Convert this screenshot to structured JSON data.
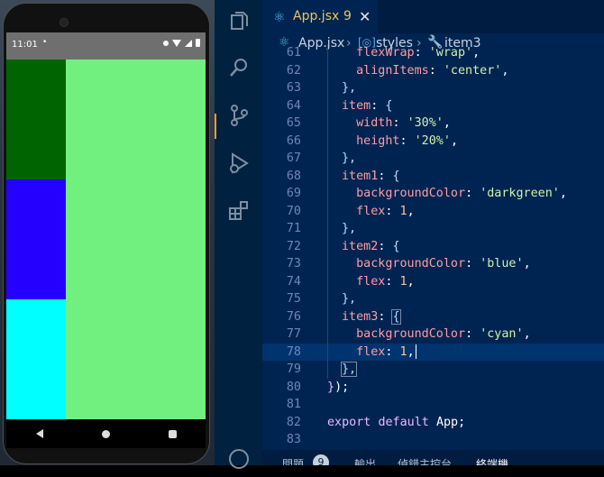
{
  "phone": {
    "status_time": "11:01",
    "status_dot": "•",
    "box_colors": [
      "#006400",
      "#2600ff",
      "#00ffff"
    ],
    "background": "#72f07f"
  },
  "editor": {
    "tab": {
      "title": "App.jsx",
      "badge": "9",
      "close": "✕"
    },
    "breadcrumb": {
      "file": "App.jsx",
      "object": "styles",
      "item": "item3"
    },
    "lines": [
      {
        "n": "61",
        "indent": 1,
        "tokens": [
          [
            "p",
            "  "
          ],
          [
            "k",
            "flexWrap"
          ],
          [
            "p",
            ": "
          ],
          [
            "s",
            "'wrap'"
          ],
          [
            "p",
            ","
          ]
        ]
      },
      {
        "n": "62",
        "indent": 1,
        "tokens": [
          [
            "p",
            "  "
          ],
          [
            "k",
            "alignItems"
          ],
          [
            "p",
            ": "
          ],
          [
            "s",
            "'center'"
          ],
          [
            "p",
            ","
          ]
        ]
      },
      {
        "n": "63",
        "indent": 1,
        "tokens": [
          [
            "b",
            "},"
          ]
        ]
      },
      {
        "n": "64",
        "indent": 1,
        "tokens": [
          [
            "k",
            "item"
          ],
          [
            "p",
            ": "
          ],
          [
            "b",
            "{"
          ]
        ]
      },
      {
        "n": "65",
        "indent": 1,
        "tokens": [
          [
            "p",
            "  "
          ],
          [
            "k",
            "width"
          ],
          [
            "p",
            ": "
          ],
          [
            "s",
            "'30%'"
          ],
          [
            "p",
            ","
          ]
        ]
      },
      {
        "n": "66",
        "indent": 1,
        "tokens": [
          [
            "p",
            "  "
          ],
          [
            "k",
            "height"
          ],
          [
            "p",
            ": "
          ],
          [
            "s",
            "'20%'"
          ],
          [
            "p",
            ","
          ]
        ]
      },
      {
        "n": "67",
        "indent": 1,
        "tokens": [
          [
            "b",
            "},"
          ]
        ]
      },
      {
        "n": "68",
        "indent": 1,
        "tokens": [
          [
            "k",
            "item1"
          ],
          [
            "p",
            ": "
          ],
          [
            "b",
            "{"
          ]
        ]
      },
      {
        "n": "69",
        "indent": 1,
        "tokens": [
          [
            "p",
            "  "
          ],
          [
            "k",
            "backgroundColor"
          ],
          [
            "p",
            ": "
          ],
          [
            "s",
            "'darkgreen'"
          ],
          [
            "p",
            ","
          ]
        ]
      },
      {
        "n": "70",
        "indent": 1,
        "tokens": [
          [
            "p",
            "  "
          ],
          [
            "k",
            "flex"
          ],
          [
            "p",
            ": "
          ],
          [
            "n",
            "1"
          ],
          [
            "p",
            ","
          ]
        ]
      },
      {
        "n": "71",
        "indent": 1,
        "tokens": [
          [
            "b",
            "},"
          ]
        ]
      },
      {
        "n": "72",
        "indent": 1,
        "tokens": [
          [
            "k",
            "item2"
          ],
          [
            "p",
            ": "
          ],
          [
            "b",
            "{"
          ]
        ]
      },
      {
        "n": "73",
        "indent": 1,
        "tokens": [
          [
            "p",
            "  "
          ],
          [
            "k",
            "backgroundColor"
          ],
          [
            "p",
            ": "
          ],
          [
            "s",
            "'blue'"
          ],
          [
            "p",
            ","
          ]
        ]
      },
      {
        "n": "74",
        "indent": 1,
        "tokens": [
          [
            "p",
            "  "
          ],
          [
            "k",
            "flex"
          ],
          [
            "p",
            ": "
          ],
          [
            "n",
            "1"
          ],
          [
            "p",
            ","
          ]
        ]
      },
      {
        "n": "75",
        "indent": 1,
        "tokens": [
          [
            "b",
            "},"
          ]
        ]
      },
      {
        "n": "76",
        "indent": 1,
        "tokens": [
          [
            "k",
            "item3"
          ],
          [
            "p",
            ": "
          ],
          [
            "b",
            "{"
          ]
        ]
      },
      {
        "n": "77",
        "indent": 1,
        "tokens": [
          [
            "p",
            "  "
          ],
          [
            "k",
            "backgroundColor"
          ],
          [
            "p",
            ": "
          ],
          [
            "s",
            "'cyan'"
          ],
          [
            "p",
            ","
          ]
        ]
      },
      {
        "n": "78",
        "indent": 1,
        "current": true,
        "tokens": [
          [
            "p",
            "  "
          ],
          [
            "k",
            "flex"
          ],
          [
            "p",
            ": "
          ],
          [
            "n",
            "1"
          ],
          [
            "p",
            ","
          ]
        ]
      },
      {
        "n": "79",
        "indent": 1,
        "tokens": [
          [
            "b",
            "},"
          ]
        ]
      },
      {
        "n": "80",
        "indent": 0,
        "tokens": [
          [
            "kw",
            "}"
          ],
          [
            "p",
            ");"
          ]
        ]
      },
      {
        "n": "81",
        "indent": 0,
        "tokens": []
      },
      {
        "n": "82",
        "indent": 0,
        "tokens": [
          [
            "kw",
            "export"
          ],
          [
            "p",
            " "
          ],
          [
            "kw",
            "default"
          ],
          [
            "p",
            " "
          ],
          [
            "p",
            "App;"
          ]
        ]
      },
      {
        "n": "83",
        "indent": 0,
        "tokens": []
      }
    ]
  },
  "panel": {
    "problems": "問題",
    "problems_count": "9",
    "output": "輸出",
    "debug_console": "偵錯主控台",
    "terminal": "終端機"
  }
}
